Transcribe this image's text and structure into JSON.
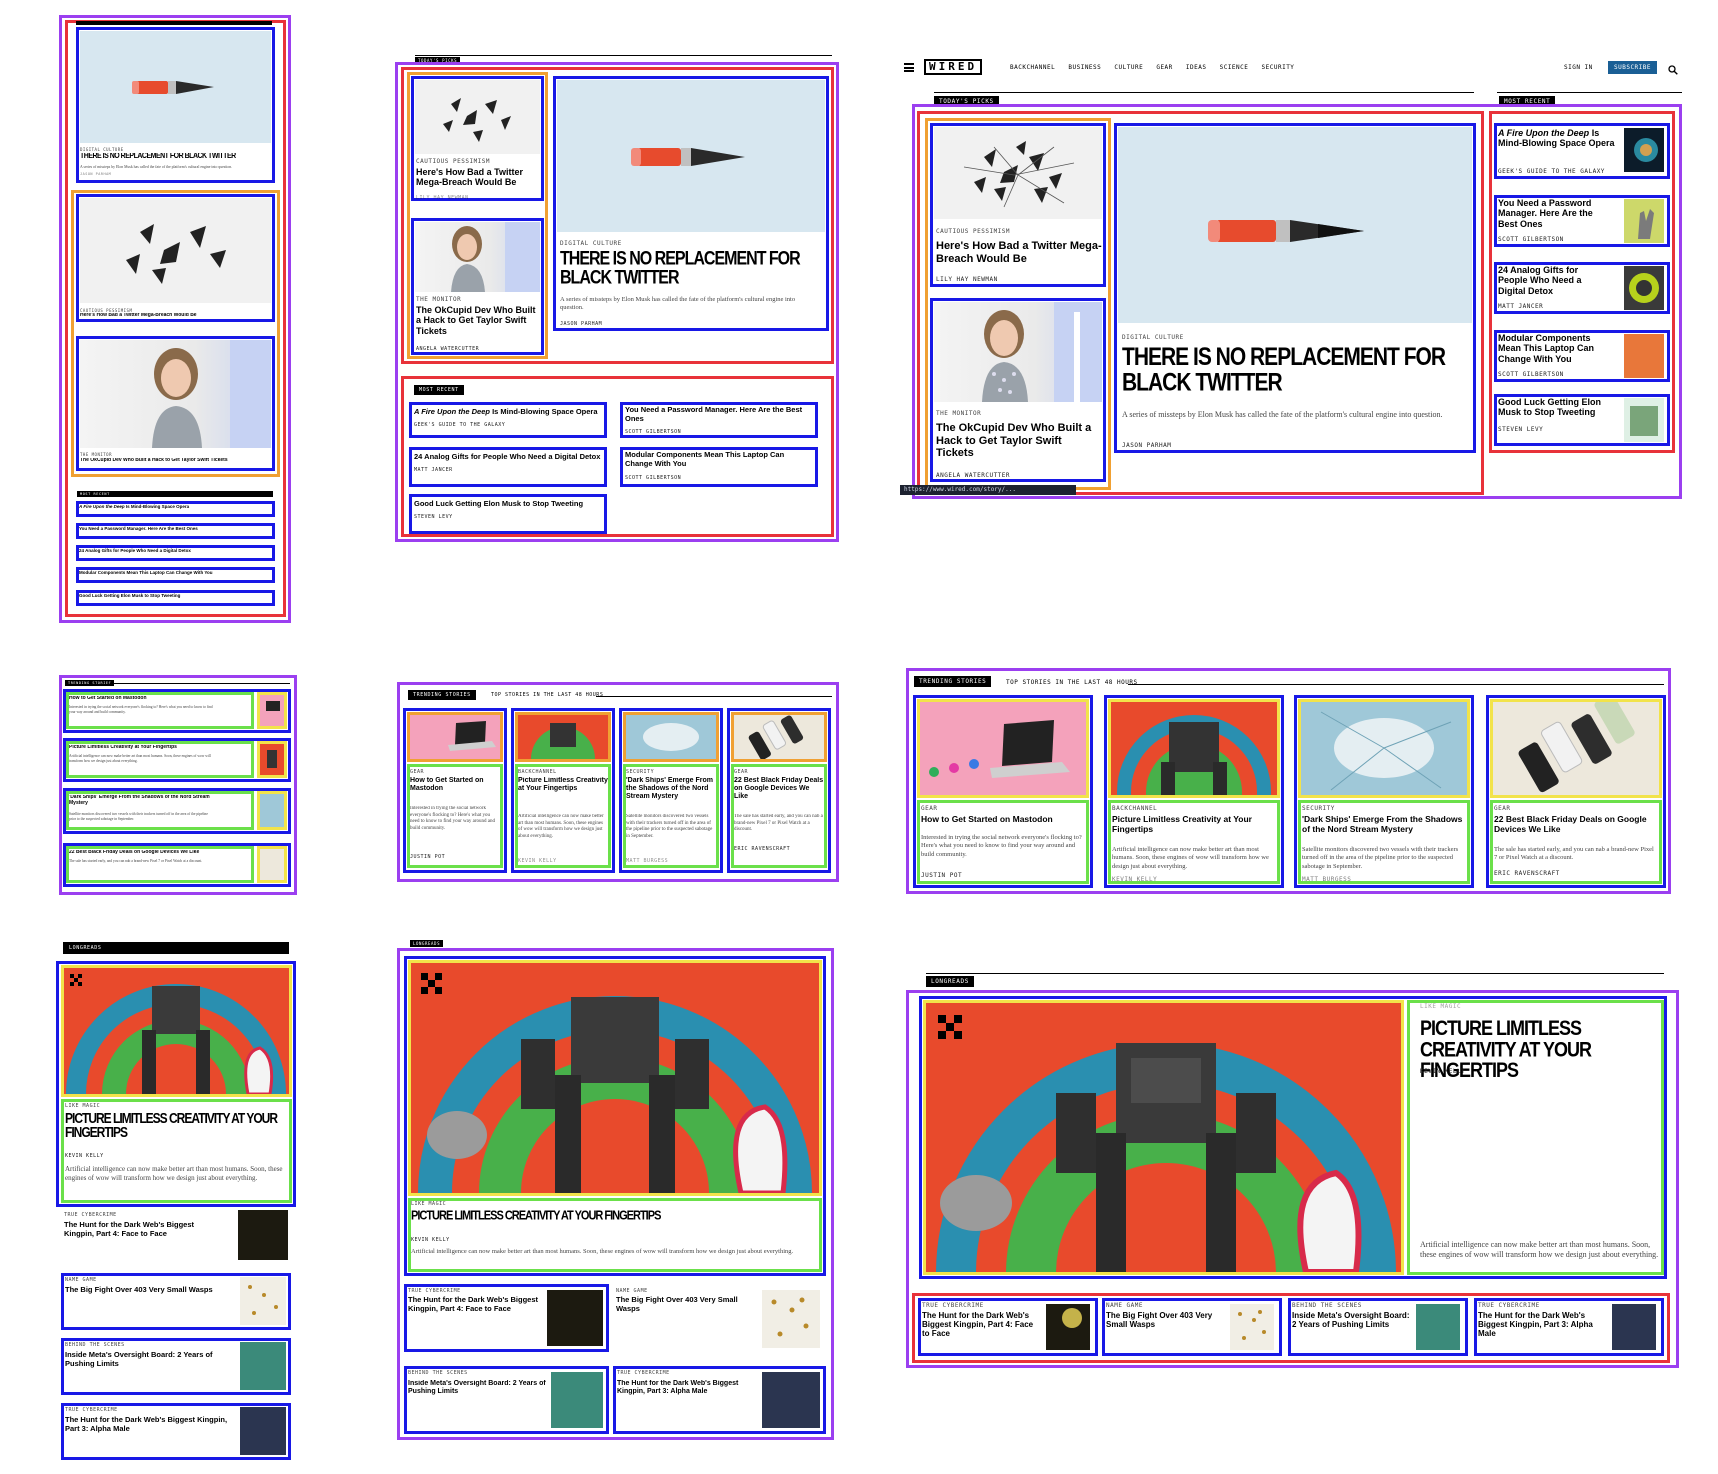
{
  "header": {
    "logo": "WIRED",
    "nav": [
      "BACKCHANNEL",
      "BUSINESS",
      "CULTURE",
      "GEAR",
      "IDEAS",
      "SCIENCE",
      "SECURITY"
    ],
    "sign_in": "SIGN IN",
    "subscribe": "SUBSCRIBE"
  },
  "sections": {
    "todays_picks": "TODAY'S PICKS",
    "most_recent": "MOST RECENT",
    "trending": "TRENDING STORIES",
    "trending_sub": "TOP STORIES IN THE LAST 48 HOURS",
    "longreads": "LONGREADS"
  },
  "status_url": "https://www.wired.com/story/...",
  "hero": {
    "kicker": "DIGITAL CULTURE",
    "title": "THERE IS NO REPLACEMENT FOR BLACK TWITTER",
    "dek": "A series of missteps by Elon Musk has called the fate of the platform's cultural engine into question.",
    "dek_short": "A series of missteps by Elon Musk has called the fate of the platform's cultural engine into question.",
    "byline": "JASON PARHAM"
  },
  "picks": [
    {
      "kicker": "CAUTIOUS PESSIMISM",
      "title": "Here's How Bad a Twitter Mega-Breach Would Be",
      "byline": "LILY HAY NEWMAN"
    },
    {
      "kicker": "THE MONITOR",
      "title": "The OkCupid Dev Who Built a Hack to Get Taylor Swift Tickets",
      "byline": "ANGELA WATERCUTTER"
    }
  ],
  "recent": [
    {
      "title_em": "A Fire Upon the Deep",
      "title_rest": " Is Mind-Blowing Space Opera",
      "byline": "GEEK'S GUIDE TO THE GALAXY"
    },
    {
      "title": "You Need a Password Manager. Here Are the Best Ones",
      "byline": "SCOTT GILBERTSON"
    },
    {
      "title": "24 Analog Gifts for People Who Need a Digital Detox",
      "byline": "MATT JANCER"
    },
    {
      "title": "Modular Components Mean This Laptop Can Change With You",
      "byline": "SCOTT GILBERTSON"
    },
    {
      "title": "Good Luck Getting Elon Musk to Stop Tweeting",
      "byline": "STEVEN LEVY"
    }
  ],
  "trending": [
    {
      "kicker": "GEAR",
      "title": "How to Get Started on Mastodon",
      "dek": "Interested in trying the social network everyone's flocking to? Here's what you need to know to find your way around and build community.",
      "byline": "JUSTIN POT"
    },
    {
      "kicker": "BACKCHANNEL",
      "title": "Picture Limitless Creativity at Your Fingertips",
      "dek": "Artificial intelligence can now make better art than most humans. Soon, these engines of wow will transform how we design just about everything.",
      "byline": "KEVIN KELLY"
    },
    {
      "kicker": "SECURITY",
      "title": "'Dark Ships' Emerge From the Shadows of the Nord Stream Mystery",
      "dek": "Satellite monitors discovered two vessels with their trackers turned off in the area of the pipeline prior to the suspected sabotage in September.",
      "byline": "MATT BURGESS"
    },
    {
      "kicker": "GEAR",
      "title": "22 Best Black Friday Deals on Google Devices We Like",
      "dek": "The sale has started early, and you can nab a brand-new Pixel 7 or Pixel Watch at a discount.",
      "byline": "ERIC RAVENSCRAFT"
    }
  ],
  "longread": {
    "kicker": "LIKE MAGIC",
    "title": "PICTURE LIMITLESS CREATIVITY AT YOUR FINGERTIPS",
    "byline": "KEVIN KELLY",
    "dek": "Artificial intelligence can now make better art than most humans. Soon, these engines of wow will transform how we design just about everything."
  },
  "long_items": [
    {
      "kicker": "TRUE CYBERCRIME",
      "title": "The Hunt for the Dark Web's Biggest Kingpin, Part 4: Face to Face"
    },
    {
      "kicker": "NAME GAME",
      "title": "The Big Fight Over 403 Very Small Wasps"
    },
    {
      "kicker": "BEHIND THE SCENES",
      "title": "Inside Meta's Oversight Board: 2 Years of Pushing Limits"
    },
    {
      "kicker": "TRUE CYBERCRIME",
      "title": "The Hunt for the Dark Web's Biggest Kingpin, Part 3: Alpha Male"
    }
  ],
  "colors": {
    "purple": "#9b3ff0",
    "red": "#e8323a",
    "orange": "#f0a032",
    "blue": "#1818e6",
    "green": "#6be04a",
    "yellow": "#f2e34a",
    "subscribe": "#1a5f95"
  },
  "icons": [
    "menu-icon",
    "search-icon",
    "pencil-image",
    "crack-image",
    "taylor-image",
    "robot-image"
  ]
}
